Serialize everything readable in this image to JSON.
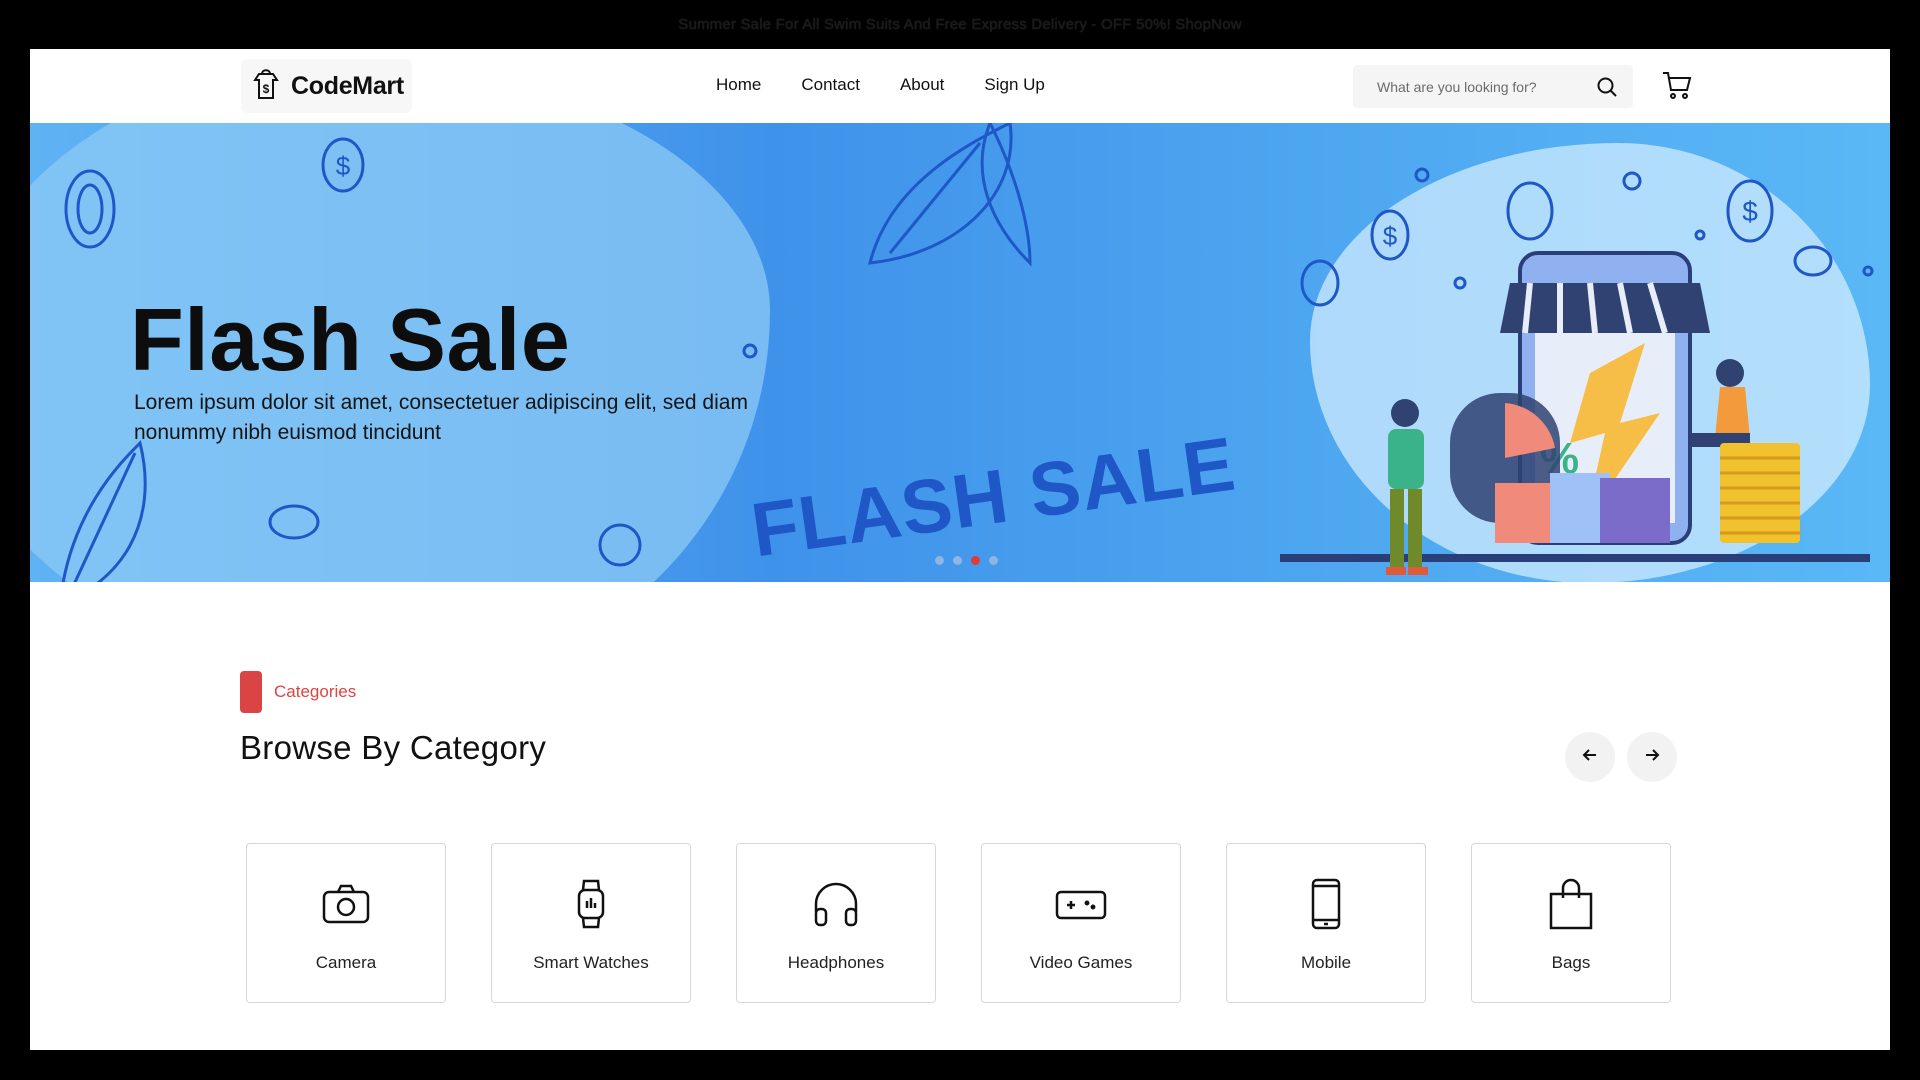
{
  "topbar": {
    "text": "Summer Sale For All Swim Suits And Free Express Delivery - OFF 50%! ShopNow"
  },
  "header": {
    "brand": "CodeMart",
    "nav": [
      {
        "label": "Home"
      },
      {
        "label": "Contact"
      },
      {
        "label": "About"
      },
      {
        "label": "Sign Up"
      }
    ],
    "search": {
      "placeholder": "What are you looking for?",
      "value": ""
    },
    "icons": {
      "search": "search-icon",
      "cart": "cart-icon",
      "logo": "shop-bag-dollar-icon"
    }
  },
  "hero": {
    "headline": "Flash Sale",
    "subtext": "Lorem ipsum dolor sit amet, consectetuer adipiscing elit, sed diam nonummy nibh euismod tincidunt",
    "stamp_text": "FLASH SALE",
    "slides": {
      "total": 4,
      "active": 3
    },
    "colors": {
      "background": "#4ea7f0",
      "active_dot": "#e53935"
    }
  },
  "categories": {
    "tag": "Categories",
    "title": "Browse By Category",
    "accent": "#db4444",
    "items": [
      {
        "label": "Camera",
        "icon": "camera-icon"
      },
      {
        "label": "Smart Watches",
        "icon": "smartwatch-icon"
      },
      {
        "label": "Headphones",
        "icon": "headphones-icon"
      },
      {
        "label": "Video Games",
        "icon": "gamepad-icon"
      },
      {
        "label": "Mobile",
        "icon": "phone-icon"
      },
      {
        "label": "Bags",
        "icon": "bag-icon"
      }
    ]
  }
}
